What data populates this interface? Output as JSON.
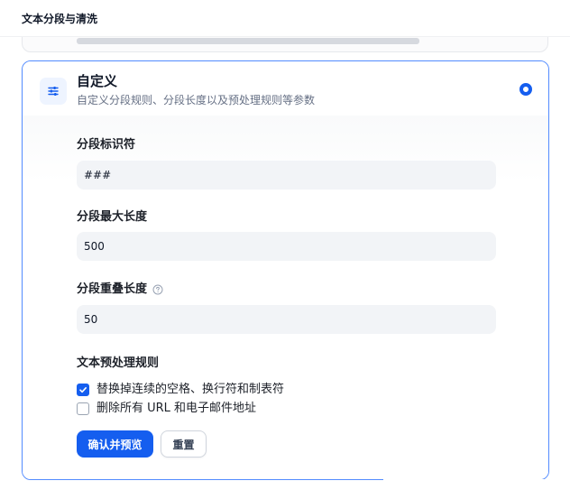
{
  "header": {
    "title": "文本分段与清洗"
  },
  "custom_card": {
    "title": "自定义",
    "description": "自定义分段规则、分段长度以及预处理规则等参数",
    "selected": true,
    "icon": "sliders-icon",
    "accent_color": "#155eef"
  },
  "fields": {
    "separator": {
      "label": "分段标识符",
      "value": "###"
    },
    "max_length": {
      "label": "分段最大长度",
      "value": "500"
    },
    "overlap": {
      "label": "分段重叠长度",
      "value": "50",
      "help_icon": "question-circle-icon"
    }
  },
  "preprocess": {
    "label": "文本预处理规则",
    "rules": [
      {
        "label": "替换掉连续的空格、换行符和制表符",
        "checked": true
      },
      {
        "label": "删除所有 URL 和电子邮件地址",
        "checked": false
      }
    ]
  },
  "actions": {
    "confirm_label": "确认并预览",
    "reset_label": "重置"
  }
}
